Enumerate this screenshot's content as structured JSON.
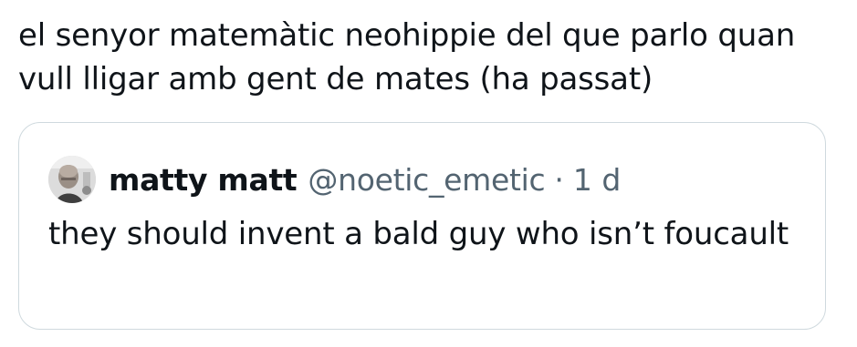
{
  "tweet": {
    "text": "el senyor matemàtic neohippie del que parlo quan vull lligar amb gent de mates (ha passat)"
  },
  "quote": {
    "author_name": "matty matt",
    "author_handle": "@noetic_emetic",
    "separator": "·",
    "time_ago": "1 d",
    "text": "they should invent a bald guy who isn’t foucault"
  },
  "colors": {
    "text_primary": "#0f1419",
    "text_secondary": "#536471",
    "border": "#cfd9de",
    "background": "#ffffff"
  },
  "icons": {
    "avatar": "profile-photo"
  }
}
